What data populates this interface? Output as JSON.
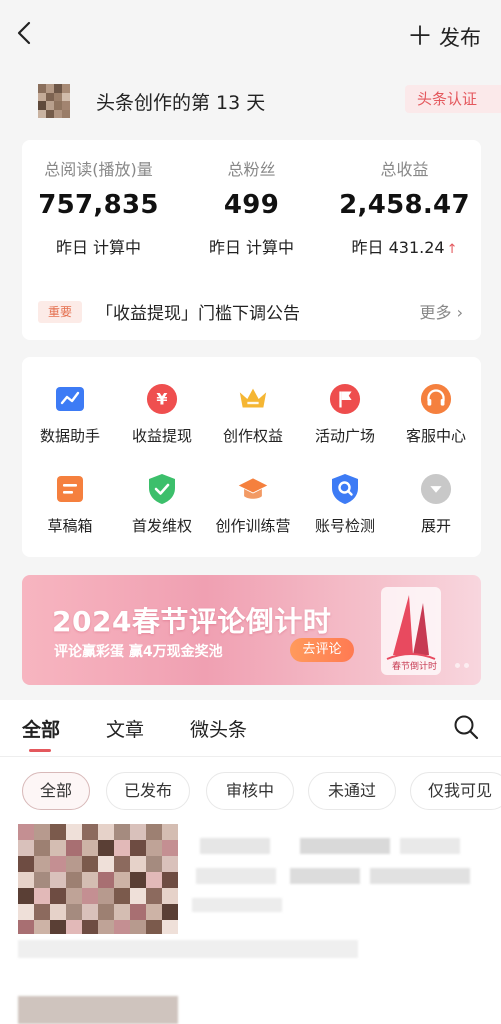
{
  "topbar": {
    "back_icon": "chevron-left-icon",
    "publish_label": "发布"
  },
  "profile": {
    "title": "头条创作的第 13 天",
    "verify_label": "头条认证"
  },
  "stats": [
    {
      "label": "总阅读(播放)量",
      "value": "757,835",
      "sub": "昨日 计算中",
      "trend": ""
    },
    {
      "label": "总粉丝",
      "value": "499",
      "sub": "昨日 计算中",
      "trend": ""
    },
    {
      "label": "总收益",
      "value": "2,458.47",
      "sub": "昨日 431.24",
      "trend": "↑"
    }
  ],
  "notice": {
    "tag": "重要",
    "text": "「收益提现」门槛下调公告",
    "more": "更多"
  },
  "tools": [
    {
      "label": "数据助手",
      "icon": "chart-icon",
      "color": "#3d7bf5"
    },
    {
      "label": "收益提现",
      "icon": "yuan-icon",
      "color": "#ef4f4f"
    },
    {
      "label": "创作权益",
      "icon": "crown-icon",
      "color": "#f5b633"
    },
    {
      "label": "活动广场",
      "icon": "flag-icon",
      "color": "#ee4d4d"
    },
    {
      "label": "客服中心",
      "icon": "headset-icon",
      "color": "#f5803e"
    },
    {
      "label": "草稿箱",
      "icon": "draft-icon",
      "color": "#f5803e"
    },
    {
      "label": "首发维权",
      "icon": "shield-icon",
      "color": "#3cbf6b"
    },
    {
      "label": "创作训练营",
      "icon": "graduation-cap-icon",
      "color": "#f5803e"
    },
    {
      "label": "账号检测",
      "icon": "search-shield-icon",
      "color": "#3d7bf5"
    },
    {
      "label": "展开",
      "icon": "chevron-down-icon",
      "color": "#c8c8c8"
    }
  ],
  "banner": {
    "title": "2024春节评论倒计时",
    "subtitle": "评论赢彩蛋 赢4万现金奖池",
    "button": "去评论",
    "art_label": "春节倒计时"
  },
  "tabs": [
    "全部",
    "文章",
    "微头条"
  ],
  "chips": [
    "全部",
    "已发布",
    "审核中",
    "未通过",
    "仅我可见"
  ]
}
